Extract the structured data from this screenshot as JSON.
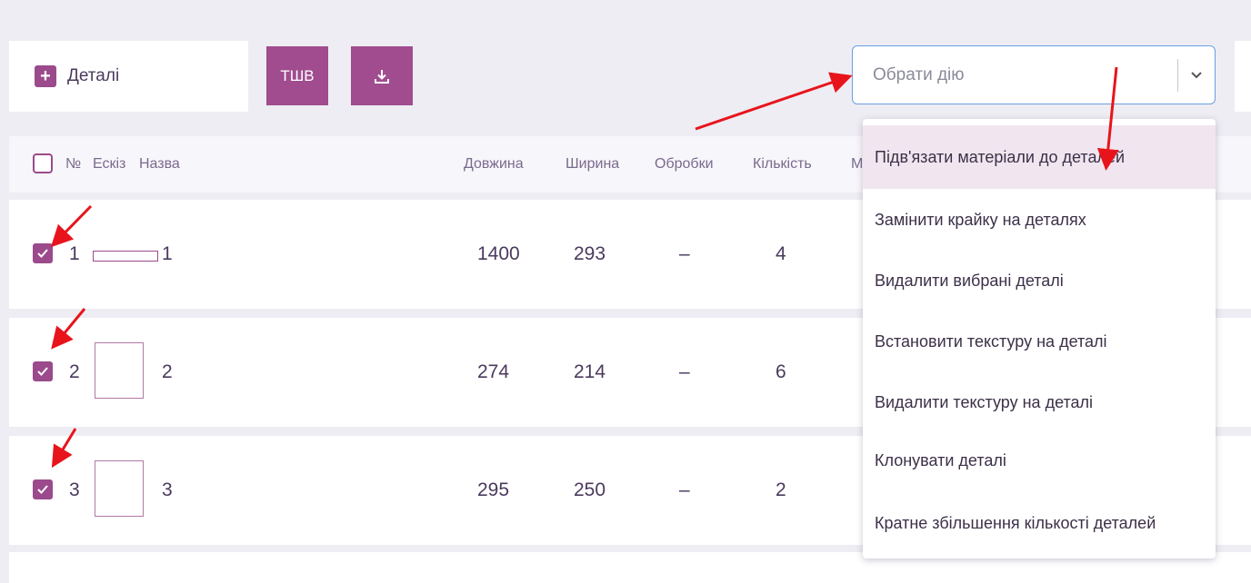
{
  "toolbar": {
    "details_tab_label": "Деталі",
    "tshv_button_label": "ТШВ",
    "action_select_placeholder": "Обрати дію"
  },
  "table": {
    "headers": {
      "number": "№",
      "sketch": "Ескіз",
      "name": "Назва",
      "length": "Довжина",
      "width": "Ширина",
      "processing": "Обробки",
      "quantity": "Кількість",
      "material_partial": "Ма"
    },
    "rows": [
      {
        "num": "1",
        "name": "1",
        "length": "1400",
        "width": "293",
        "processing": "–",
        "quantity": "4",
        "checked": true
      },
      {
        "num": "2",
        "name": "2",
        "length": "274",
        "width": "214",
        "processing": "–",
        "quantity": "6",
        "checked": true
      },
      {
        "num": "3",
        "name": "3",
        "length": "295",
        "width": "250",
        "processing": "–",
        "quantity": "2",
        "checked": true
      }
    ]
  },
  "action_menu": {
    "items": [
      "Підв'язати матеріали до деталей",
      "Замінити крайку на деталях",
      "Видалити вибрані деталі",
      "Встановити текстуру на деталі",
      "Видалити текстуру на деталі",
      "Клонувати деталі",
      "Кратне збільшення кількості деталей"
    ],
    "active_index": 0
  },
  "colors": {
    "accent": "#a04c8f",
    "annotation_arrow": "#e8141c",
    "select_focus_border": "#6aa0e0"
  },
  "icons": [
    "plus-icon",
    "download-icon",
    "chevron-down-icon",
    "check-icon",
    "annotation-arrow"
  ]
}
